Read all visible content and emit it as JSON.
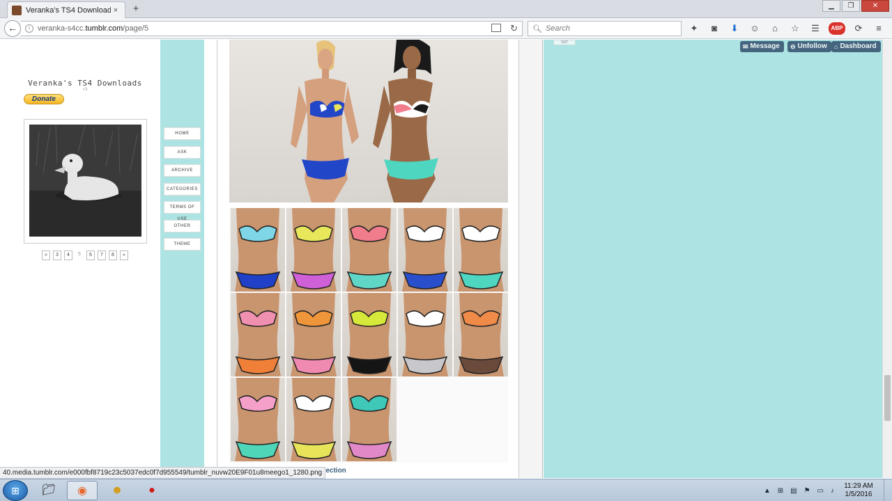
{
  "browser": {
    "tab_title": "Veranka's TS4 Downloads",
    "tab_close": "×",
    "new_tab": "+",
    "url_prefix": "veranka-s4cc.",
    "url_domain": "tumblr.com",
    "url_path": "/page/5",
    "search_placeholder": "Search",
    "abp_label": "ABP"
  },
  "window_controls": {
    "minimize": "▁",
    "maximize": "❐",
    "close": "✕"
  },
  "sidebar": {
    "blog_title": "Veranka's TS4 Downloads",
    "blog_subtitle": "<3",
    "donate_label": "Donate",
    "pagination": [
      "«",
      "3",
      "4",
      "5",
      "6",
      "7",
      "8",
      "»"
    ],
    "current_page": "5"
  },
  "nav_buttons": [
    "HOME",
    "ASK",
    "ARCHIVE",
    "CATEGORIES",
    "TERMS OF USE",
    "OTHER",
    "THEME"
  ],
  "post": {
    "copy_link": "py Collection",
    "swatch_colors": [
      {
        "top": "#7fd6e6",
        "bottom": "#2040c8"
      },
      {
        "top": "#e8e65a",
        "bottom": "#d060d8"
      },
      {
        "top": "#f07c8c",
        "bottom": "#5fd6c6"
      },
      {
        "top": "#ffffff",
        "bottom": "#2a4fcc"
      },
      {
        "top": "#ffffff",
        "bottom": "#4fd6c0"
      },
      {
        "top": "#f090b0",
        "bottom": "#f08038"
      },
      {
        "top": "#f0963a",
        "bottom": "#f08ab0"
      },
      {
        "top": "#d6e83a",
        "bottom": "#151515"
      },
      {
        "top": "#ffffff",
        "bottom": "#c8c8cc"
      },
      {
        "top": "#f08a48",
        "bottom": "#6a4a3a"
      },
      {
        "top": "#f5a0c8",
        "bottom": "#4fd6b8"
      },
      {
        "top": "#ffffff",
        "bottom": "#e8e45a"
      },
      {
        "top": "#3fc8b8",
        "bottom": "#e088c8"
      }
    ]
  },
  "tumblr_controls": {
    "message": "Message",
    "unfollow": "Unfollow",
    "dashboard": "Dashboard",
    "sep_tag": "SEP"
  },
  "status_url": "40.media.tumblr.com/e000fbf8719c23c5037edc0f7d955549/tumblr_nuvw20E9F01u8meego1_1280.png",
  "taskbar": {
    "time": "11:29 AM",
    "date": "1/5/2016"
  }
}
